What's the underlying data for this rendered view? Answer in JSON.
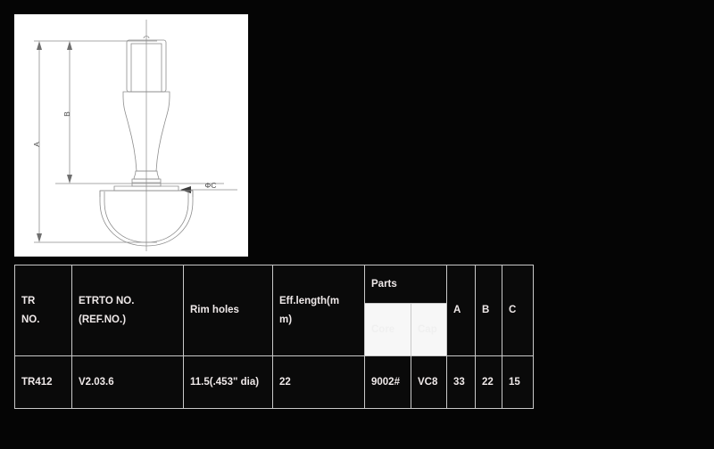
{
  "drawing": {
    "title": "tire-valve-stem-technical-drawing",
    "background_color": "#ffffff",
    "line_color": "#8a8a8a",
    "dimension_labels": {
      "overall_length": "A",
      "upper_length": "B",
      "diameter": "ΦC"
    }
  },
  "table": {
    "headers": {
      "tr_no_line1": "TR",
      "tr_no_line2": "NO.",
      "etrto_line1": "ETRTO NO.",
      "etrto_line2": "(REF.NO.)",
      "rim_holes": "Rim holes",
      "eff_length_line1": "Eff.length(m",
      "eff_length_line2": "m)",
      "parts": "Parts",
      "parts_core": "Core",
      "parts_cap": "Cap",
      "a": "A",
      "b": "B",
      "c": "C"
    },
    "rows": [
      {
        "tr_no": "TR412",
        "etrto_no": "V2.03.6",
        "rim_holes": "11.5(.453\" dia)",
        "eff_length": "22",
        "parts_core": "9002#",
        "parts_cap": "VC8",
        "a": "33",
        "b": "22",
        "c": "15"
      }
    ]
  },
  "colors": {
    "page_background": "#050505",
    "table_border": "#c9c9c9",
    "table_text": "#efe9e9",
    "subheader_background": "#f7f7f7",
    "subheader_text": "#f0f0f0"
  }
}
